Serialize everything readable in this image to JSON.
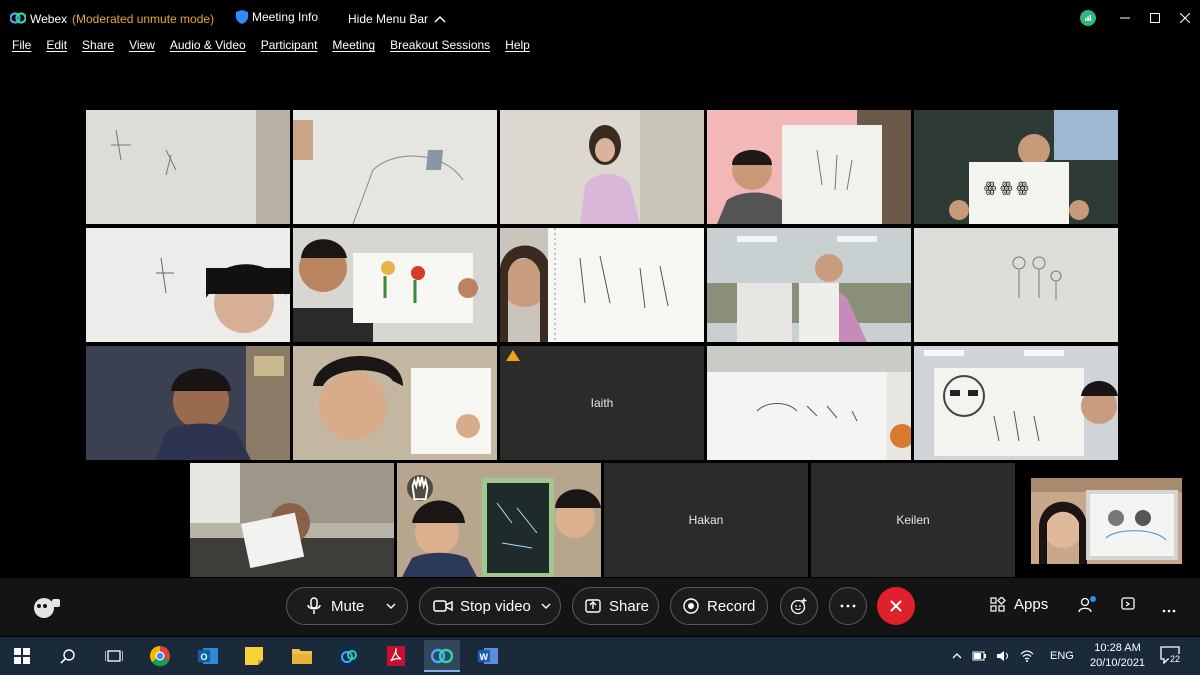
{
  "titlebar": {
    "app_name": "Webex",
    "mode": "(Moderated unmute mode)",
    "meeting_info": "Meeting Info",
    "hide_menu": "Hide Menu Bar"
  },
  "menu": [
    "File",
    "Edit",
    "Share",
    "View",
    "Audio & Video",
    "Participant",
    "Meeting",
    "Breakout Sessions",
    "Help"
  ],
  "participants": {
    "iaith": "Iaith",
    "hakan": "Hakan",
    "keilen": "Keilen"
  },
  "controls": {
    "mute": "Mute",
    "stop_video": "Stop video",
    "share": "Share",
    "record": "Record",
    "apps": "Apps"
  },
  "taskbar": {
    "language": "ENG",
    "time": "10:28 AM",
    "date": "20/10/2021",
    "notifications": "22"
  },
  "colors": {
    "mode_text": "#e8a33a",
    "end_call": "#e0202a",
    "taskbar": "#1b2a3a"
  }
}
